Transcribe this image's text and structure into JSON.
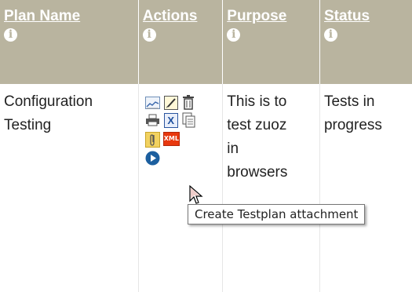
{
  "table": {
    "headers": [
      {
        "label": "Plan Name"
      },
      {
        "label": "Actions"
      },
      {
        "label": "Purpose"
      },
      {
        "label": "Status"
      }
    ],
    "info_glyph": "i",
    "rows": [
      {
        "plan_name": "Configuration Testing",
        "purpose": "This is to test zuoz in browsers",
        "status": "Tests in progress"
      }
    ]
  },
  "action_icons": [
    "chart-icon",
    "edit-icon",
    "delete-icon",
    "print-icon",
    "export-excel-icon",
    "copy-icon",
    "attachment-icon",
    "export-xml-icon",
    "execute-icon"
  ],
  "xml_icon_text": "XML",
  "excel_icon_text": "X",
  "tooltip": {
    "text": "Create Testplan attachment"
  },
  "colors": {
    "header_bg": "#b9b49f",
    "header_text": "#ffffff",
    "body_text": "#222222"
  }
}
